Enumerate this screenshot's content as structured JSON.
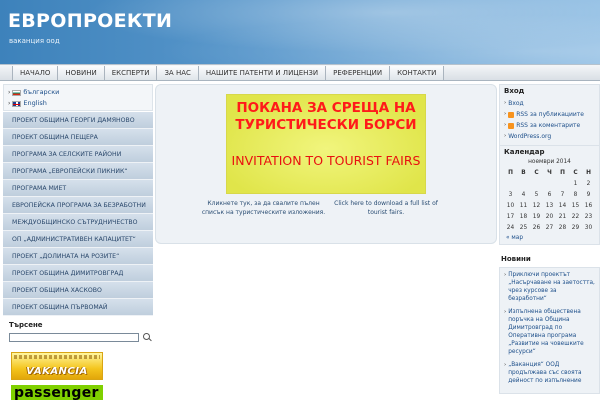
{
  "header": {
    "title": "ЕВРОПРОЕКТИ",
    "subtitle": "ваканция оод"
  },
  "nav": {
    "items": [
      "НАЧАЛО",
      "НОВИНИ",
      "ЕКСПЕРТИ",
      "ЗА НАС",
      "НАШИТЕ ПАТЕНТИ И ЛИЦЕНЗИ",
      "РЕФЕРЕНЦИИ",
      "КОНТАКТИ"
    ]
  },
  "languages": [
    {
      "label": "български",
      "flag": "bg-flag-icon"
    },
    {
      "label": "English",
      "flag": "en-flag-icon"
    }
  ],
  "sidebar_menu": [
    "ПРОЕКТ ОБЩИНА ГЕОРГИ ДАМЯНОВО",
    "ПРОЕКТ ОБЩИНА ПЕЩЕРА",
    "ПРОГРАМА ЗА СЕЛСКИТЕ РАЙОНИ",
    "ПРОГРАМА „ЕВРОПЕЙСКИ ПИКНИК“",
    "ПРОГРАМА МИЕТ",
    "ЕВРОПЕЙСКА ПРОГРАМА ЗА БЕЗРАБОТНИ",
    "МЕЖДУОБЩИНСКО СЪТРУДНИЧЕСТВО",
    "ОП „АДМИНИСТРАТИВЕН КАПАЦИТЕТ“",
    "ПРОЕКТ „ДОЛИНАТА НА РОЗИТЕ“",
    "ПРОЕКТ ОБЩИНА ДИМИТРОВГРАД",
    "ПРОЕКТ ОБЩИНА ХАСКОВО",
    "ПРОЕКТ ОБЩИНА ПЪРВОМАЙ"
  ],
  "search": {
    "title": "Търсене",
    "value": ""
  },
  "banners": {
    "vakancia": "VAKANCIA",
    "passenger": "passenger"
  },
  "main": {
    "invite_bg": "ПОКАНА ЗА СРЕЩА НА ТУРИСТИЧЕСКИ БОРСИ",
    "invite_en": "INVITATION TO TOURIST FAIRS",
    "caption_bg": "Кликнете тук, за да свалите пълен списък на туристическите изложения.",
    "caption_en": "Click here to download a full list of tourist fairs."
  },
  "login_widget": {
    "title": "Вход",
    "links": [
      {
        "label": "Вход",
        "rss": false
      },
      {
        "label": "RSS за публикациите",
        "rss": true
      },
      {
        "label": "RSS за коментарите",
        "rss": true
      },
      {
        "label": "WordPress.org",
        "rss": false
      }
    ]
  },
  "calendar": {
    "title": "Календар",
    "caption": "ноември 2014",
    "weekdays": [
      "П",
      "В",
      "С",
      "Ч",
      "П",
      "С",
      "Н"
    ],
    "weeks": [
      [
        "",
        "",
        "",
        "",
        "",
        "1",
        "2"
      ],
      [
        "3",
        "4",
        "5",
        "6",
        "7",
        "8",
        "9"
      ],
      [
        "10",
        "11",
        "12",
        "13",
        "14",
        "15",
        "16"
      ],
      [
        "17",
        "18",
        "19",
        "20",
        "21",
        "22",
        "23"
      ],
      [
        "24",
        "25",
        "26",
        "27",
        "28",
        "29",
        "30"
      ]
    ],
    "prev": "« мар"
  },
  "news": {
    "title": "Новини",
    "items": [
      "Приключи проектът „Насърчаване на заетостта, чрез курсове за безработни“",
      "Изпълнена обществена поръчка на Община Димитровград по Оперативна програма „Развитие на човешките ресурси“",
      "„Ваканция“ ООД продължава със своята дейност по изпълнение"
    ]
  }
}
